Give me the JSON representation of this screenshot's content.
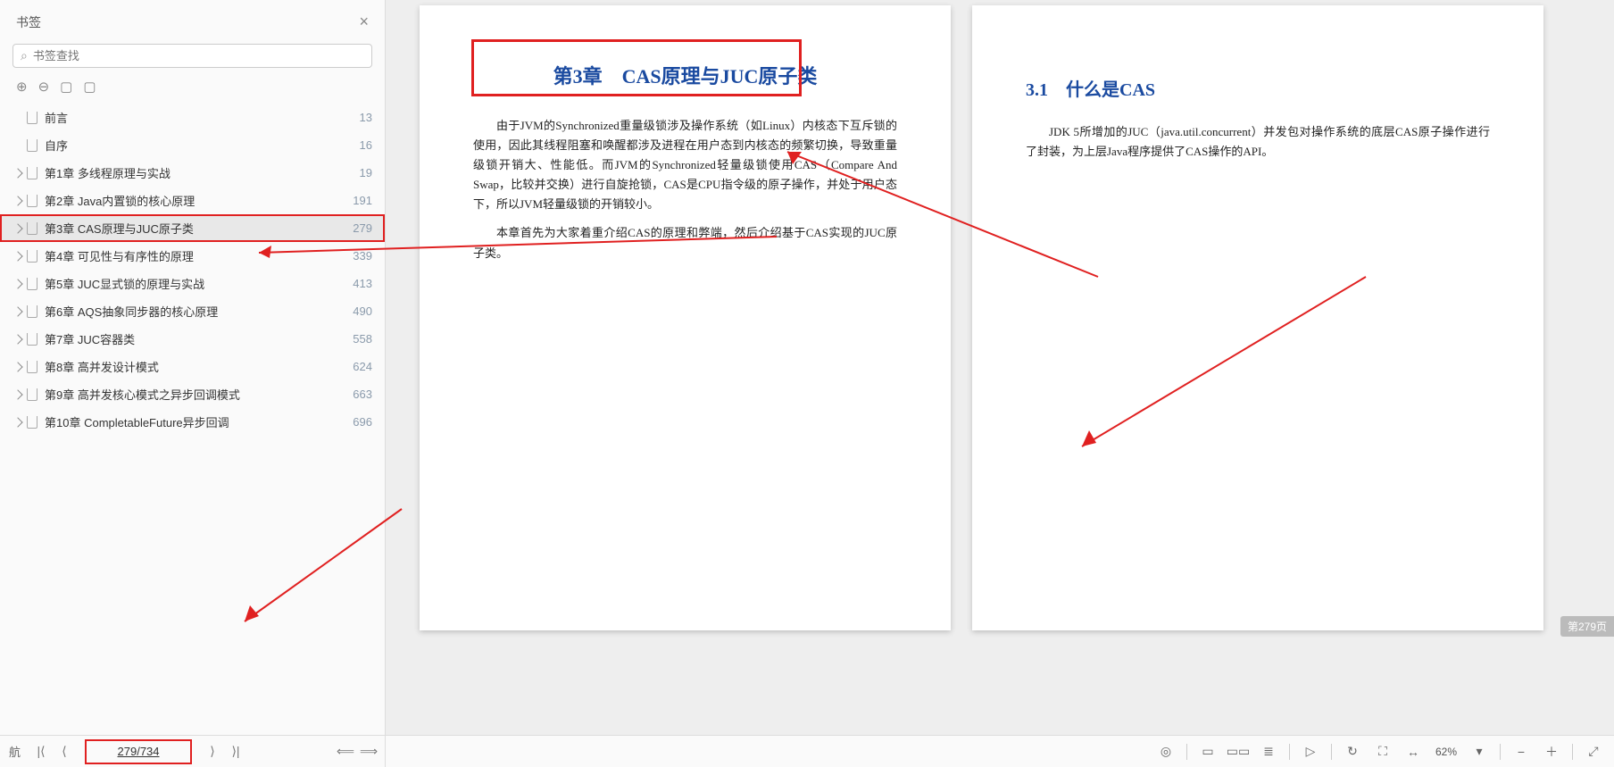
{
  "sidebar": {
    "title": "书签",
    "search_placeholder": "书签查找",
    "items": [
      {
        "label": "前言",
        "page": "13",
        "expandable": false
      },
      {
        "label": "自序",
        "page": "16",
        "expandable": false
      },
      {
        "label": "第1章 多线程原理与实战",
        "page": "19",
        "expandable": true
      },
      {
        "label": "第2章 Java内置锁的核心原理",
        "page": "191",
        "expandable": true
      },
      {
        "label": "第3章 CAS原理与JUC原子类",
        "page": "279",
        "expandable": true,
        "selected": true,
        "highlight": true
      },
      {
        "label": "第4章 可见性与有序性的原理",
        "page": "339",
        "expandable": true
      },
      {
        "label": "第5章 JUC显式锁的原理与实战",
        "page": "413",
        "expandable": true
      },
      {
        "label": "第6章 AQS抽象同步器的核心原理",
        "page": "490",
        "expandable": true
      },
      {
        "label": "第7章 JUC容器类",
        "page": "558",
        "expandable": true
      },
      {
        "label": "第8章 高并发设计模式",
        "page": "624",
        "expandable": true
      },
      {
        "label": "第9章 高并发核心模式之异步回调模式",
        "page": "663",
        "expandable": true
      },
      {
        "label": "第10章 CompletableFuture异步回调",
        "page": "696",
        "expandable": true
      }
    ]
  },
  "nav": {
    "label": "航",
    "page_display": "279/734"
  },
  "doc": {
    "left": {
      "chapter_title": "第3章　CAS原理与JUC原子类",
      "para1": "由于JVM的Synchronized重量级锁涉及操作系统（如Linux）内核态下互斥锁的使用，因此其线程阻塞和唤醒都涉及进程在用户态到内核态的频繁切换，导致重量级锁开销大、性能低。而JVM的Synchronized轻量级锁使用CAS（Compare And Swap，比较并交换）进行自旋抢锁，CAS是CPU指令级的原子操作，并处于用户态下，所以JVM轻量级锁的开销较小。",
      "para2": "本章首先为大家着重介绍CAS的原理和弊端，然后介绍基于CAS实现的JUC原子类。"
    },
    "right": {
      "section_title": "3.1　什么是CAS",
      "para1": "JDK 5所增加的JUC（java.util.concurrent）并发包对操作系统的底层CAS原子操作进行了封装，为上层Java程序提供了CAS操作的API。"
    }
  },
  "toolbar": {
    "zoom": "62%"
  },
  "page_indicator": "第279页"
}
